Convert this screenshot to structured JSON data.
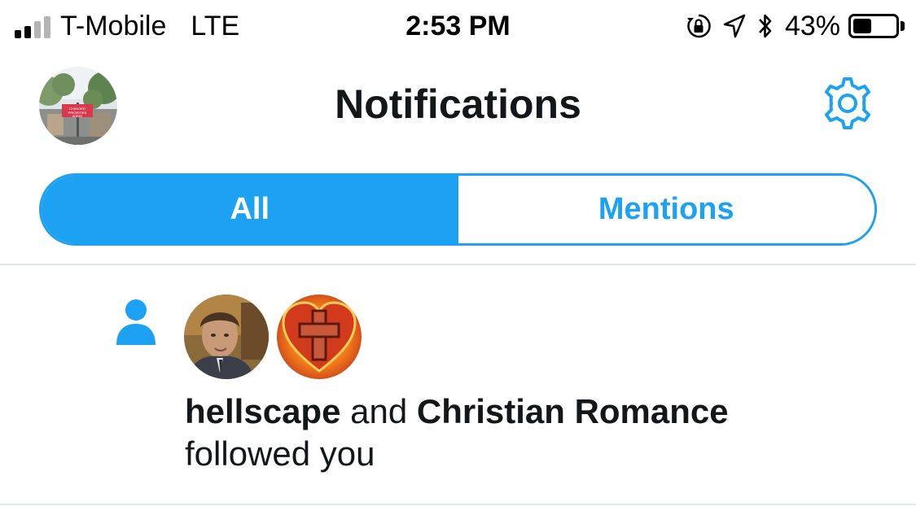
{
  "status_bar": {
    "carrier": "T-Mobile",
    "network": "LTE",
    "time": "2:53 PM",
    "battery_percent_label": "43%",
    "battery_level": 0.43,
    "signal_bars": 2,
    "icons": [
      "orientation-lock-icon",
      "location-arrow-icon",
      "bluetooth-icon",
      "battery-icon"
    ]
  },
  "header": {
    "title": "Notifications",
    "avatar_sign_text": "CHANGED PRIORITIES AHEAD",
    "settings_icon": "gear-icon"
  },
  "tabs": [
    {
      "label": "All",
      "active": true
    },
    {
      "label": "Mentions",
      "active": false
    }
  ],
  "notifications": [
    {
      "type_icon": "person-icon",
      "user1": "hellscape",
      "connector": "and",
      "user2": "Christian Romance",
      "action": "followed you"
    }
  ],
  "colors": {
    "accent": "#1da1f2",
    "text": "#14171a",
    "divider": "#e1e8ed",
    "signal_inactive": "#b5b5b5"
  }
}
